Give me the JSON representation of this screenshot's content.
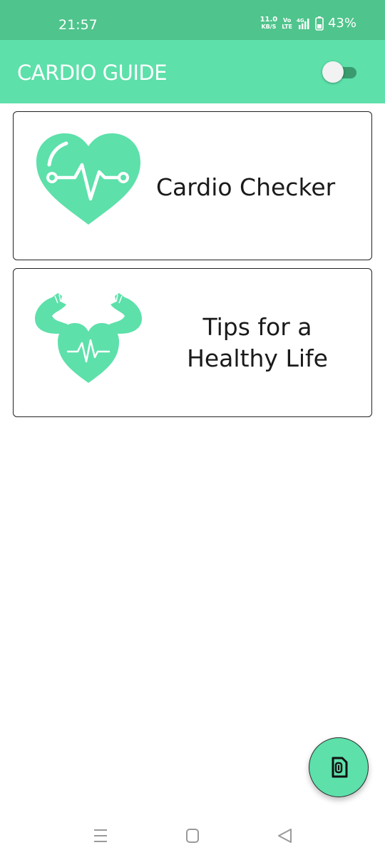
{
  "status_bar": {
    "time": "21:57",
    "net_speed_value": "11.0",
    "net_speed_unit": "KB/S",
    "volte_top": "Vo",
    "volte_bottom": "LTE",
    "network_type": "4G",
    "battery_percent": "43%",
    "icons": [
      "signal-icon",
      "battery-icon"
    ]
  },
  "app_bar": {
    "title": "CARDIO GUIDE",
    "toggle_on": false
  },
  "cards": [
    {
      "label": "Cardio Checker",
      "icon": "heart-pulse-icon"
    },
    {
      "label_line1": "Tips for a",
      "label_line2": "Healthy Life",
      "icon": "strong-heart-icon"
    }
  ],
  "fab": {
    "icon": "clipboard-icon"
  },
  "nav_bar": {
    "icons": [
      "recents-icon",
      "home-icon",
      "back-icon"
    ]
  },
  "colors": {
    "status_bar": "#4fc48c",
    "app_bar": "#5de0aa",
    "accent": "#5de0aa",
    "toggle_track": "#3a9b6e"
  }
}
